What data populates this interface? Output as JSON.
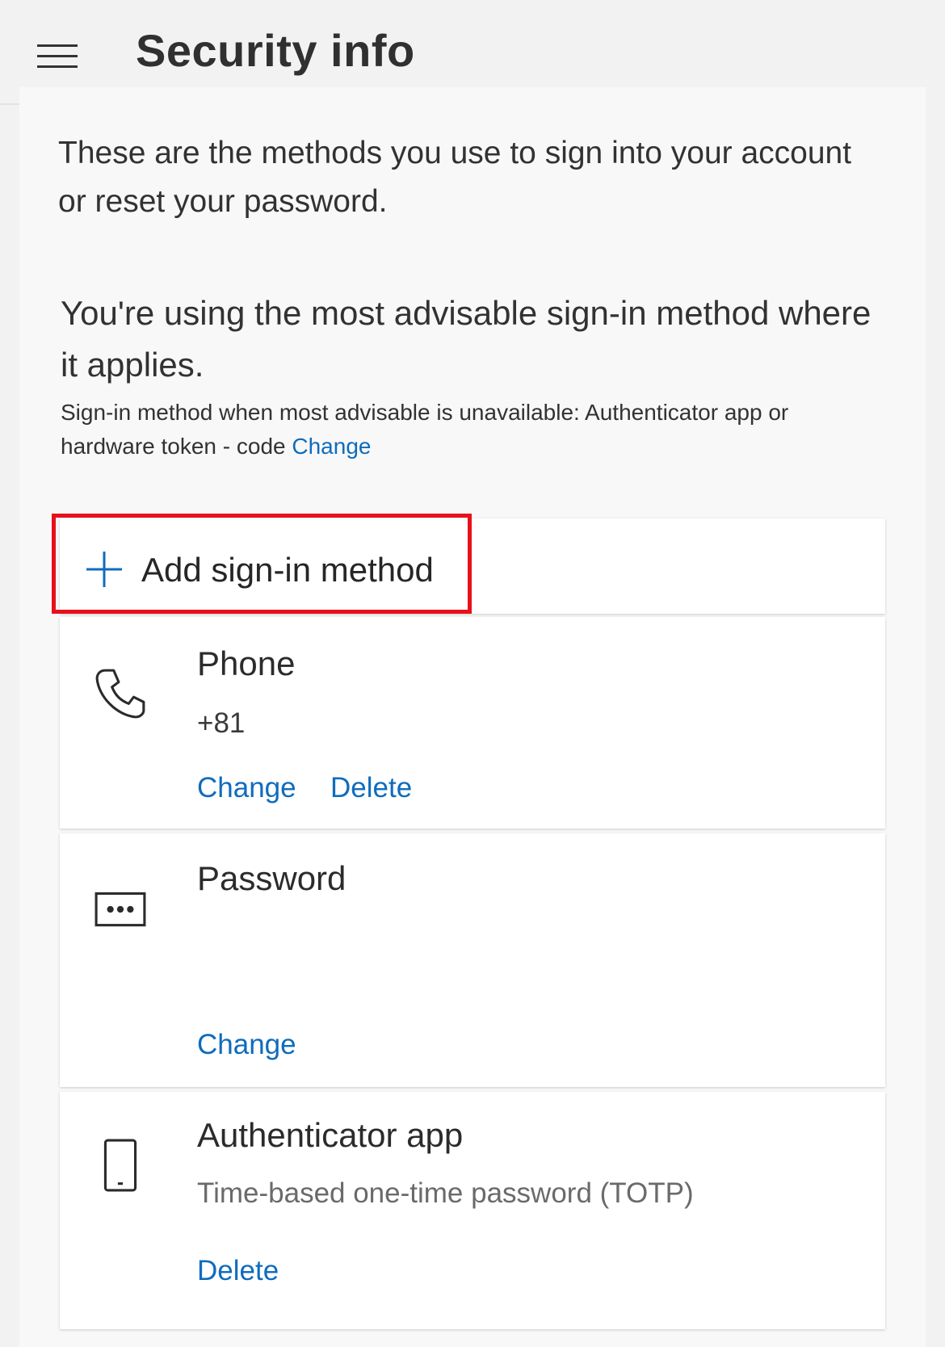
{
  "header": {
    "title": "Security info"
  },
  "intro": {
    "text": "These are the methods you use to sign into your account or reset your password."
  },
  "advisable": {
    "headline": "You're using the most advisable sign-in method where it applies.",
    "fallback_text": "Sign-in method when most advisable is unavailable: Authenticator app or hardware token - code",
    "fallback_change_label": "Change"
  },
  "add_method": {
    "label": "Add sign-in method"
  },
  "methods": [
    {
      "title": "Phone",
      "detail": "+81",
      "icon": "phone-icon",
      "actions": [
        "Change",
        "Delete"
      ]
    },
    {
      "title": "Password",
      "detail": "",
      "icon": "password-icon",
      "actions": [
        "Change"
      ]
    },
    {
      "title": "Authenticator app",
      "detail": "Time-based one-time password (TOTP)",
      "icon": "mobile-device-icon",
      "actions": [
        "Delete"
      ]
    }
  ],
  "colors": {
    "link": "#0f6cbd",
    "highlight": "#e8101b",
    "background": "#f2f2f2",
    "card": "#ffffff"
  }
}
